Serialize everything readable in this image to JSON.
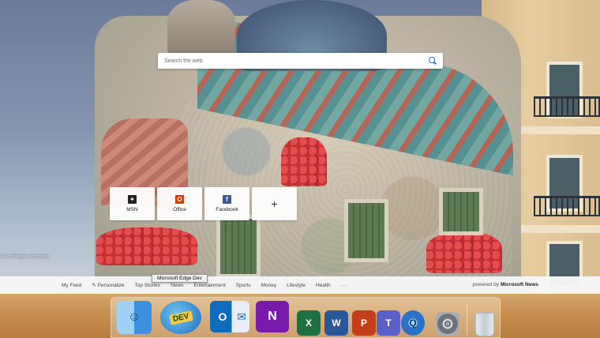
{
  "search": {
    "placeholder": "Search the web"
  },
  "tiles": [
    {
      "label": "MSN",
      "icon": "msn-icon",
      "color": "#222222"
    },
    {
      "label": "Office",
      "icon": "office-icon",
      "color": "#d83b01"
    },
    {
      "label": "Facebook",
      "icon": "facebook-icon",
      "color": "#3b5998"
    },
    {
      "label": "+",
      "icon": "add-icon"
    }
  ],
  "caption": "use of dragons and roses",
  "tooltip": "Microsoft Edge Dev",
  "feed": {
    "items": [
      "My Feed",
      "Personalize",
      "Top Stories",
      "News",
      "Entertainment",
      "Sports",
      "Money",
      "Lifestyle",
      "Health",
      "···"
    ],
    "powered_prefix": "powered by",
    "powered_brand": "Microsoft News"
  },
  "dock": {
    "edge_badge": "DEV",
    "apps": [
      {
        "name": "Finder",
        "icon": "finder-icon",
        "color": "#5aa7ea"
      },
      {
        "name": "Microsoft Edge Dev",
        "icon": "edge-dev-icon",
        "color": "#2f8fd8"
      },
      {
        "name": "Outlook",
        "icon": "outlook-icon",
        "color": "#0f6cbd"
      },
      {
        "name": "OneNote",
        "icon": "onenote-icon",
        "color": "#7719aa"
      },
      {
        "name": "Excel",
        "icon": "excel-icon",
        "color": "#1d7044"
      },
      {
        "name": "Word",
        "icon": "word-icon",
        "color": "#2b5797"
      },
      {
        "name": "PowerPoint",
        "icon": "powerpoint-icon",
        "color": "#c43e1c"
      },
      {
        "name": "Teams",
        "icon": "teams-icon",
        "color": "#5b5fc7"
      },
      {
        "name": "QuickTime",
        "icon": "quicktime-icon",
        "color": "#2a72c8"
      },
      {
        "name": "System Preferences",
        "icon": "settings-icon",
        "color": "#7b7f86"
      },
      {
        "name": "Trash",
        "icon": "trash-icon",
        "color": "#cfd6dd"
      }
    ]
  }
}
